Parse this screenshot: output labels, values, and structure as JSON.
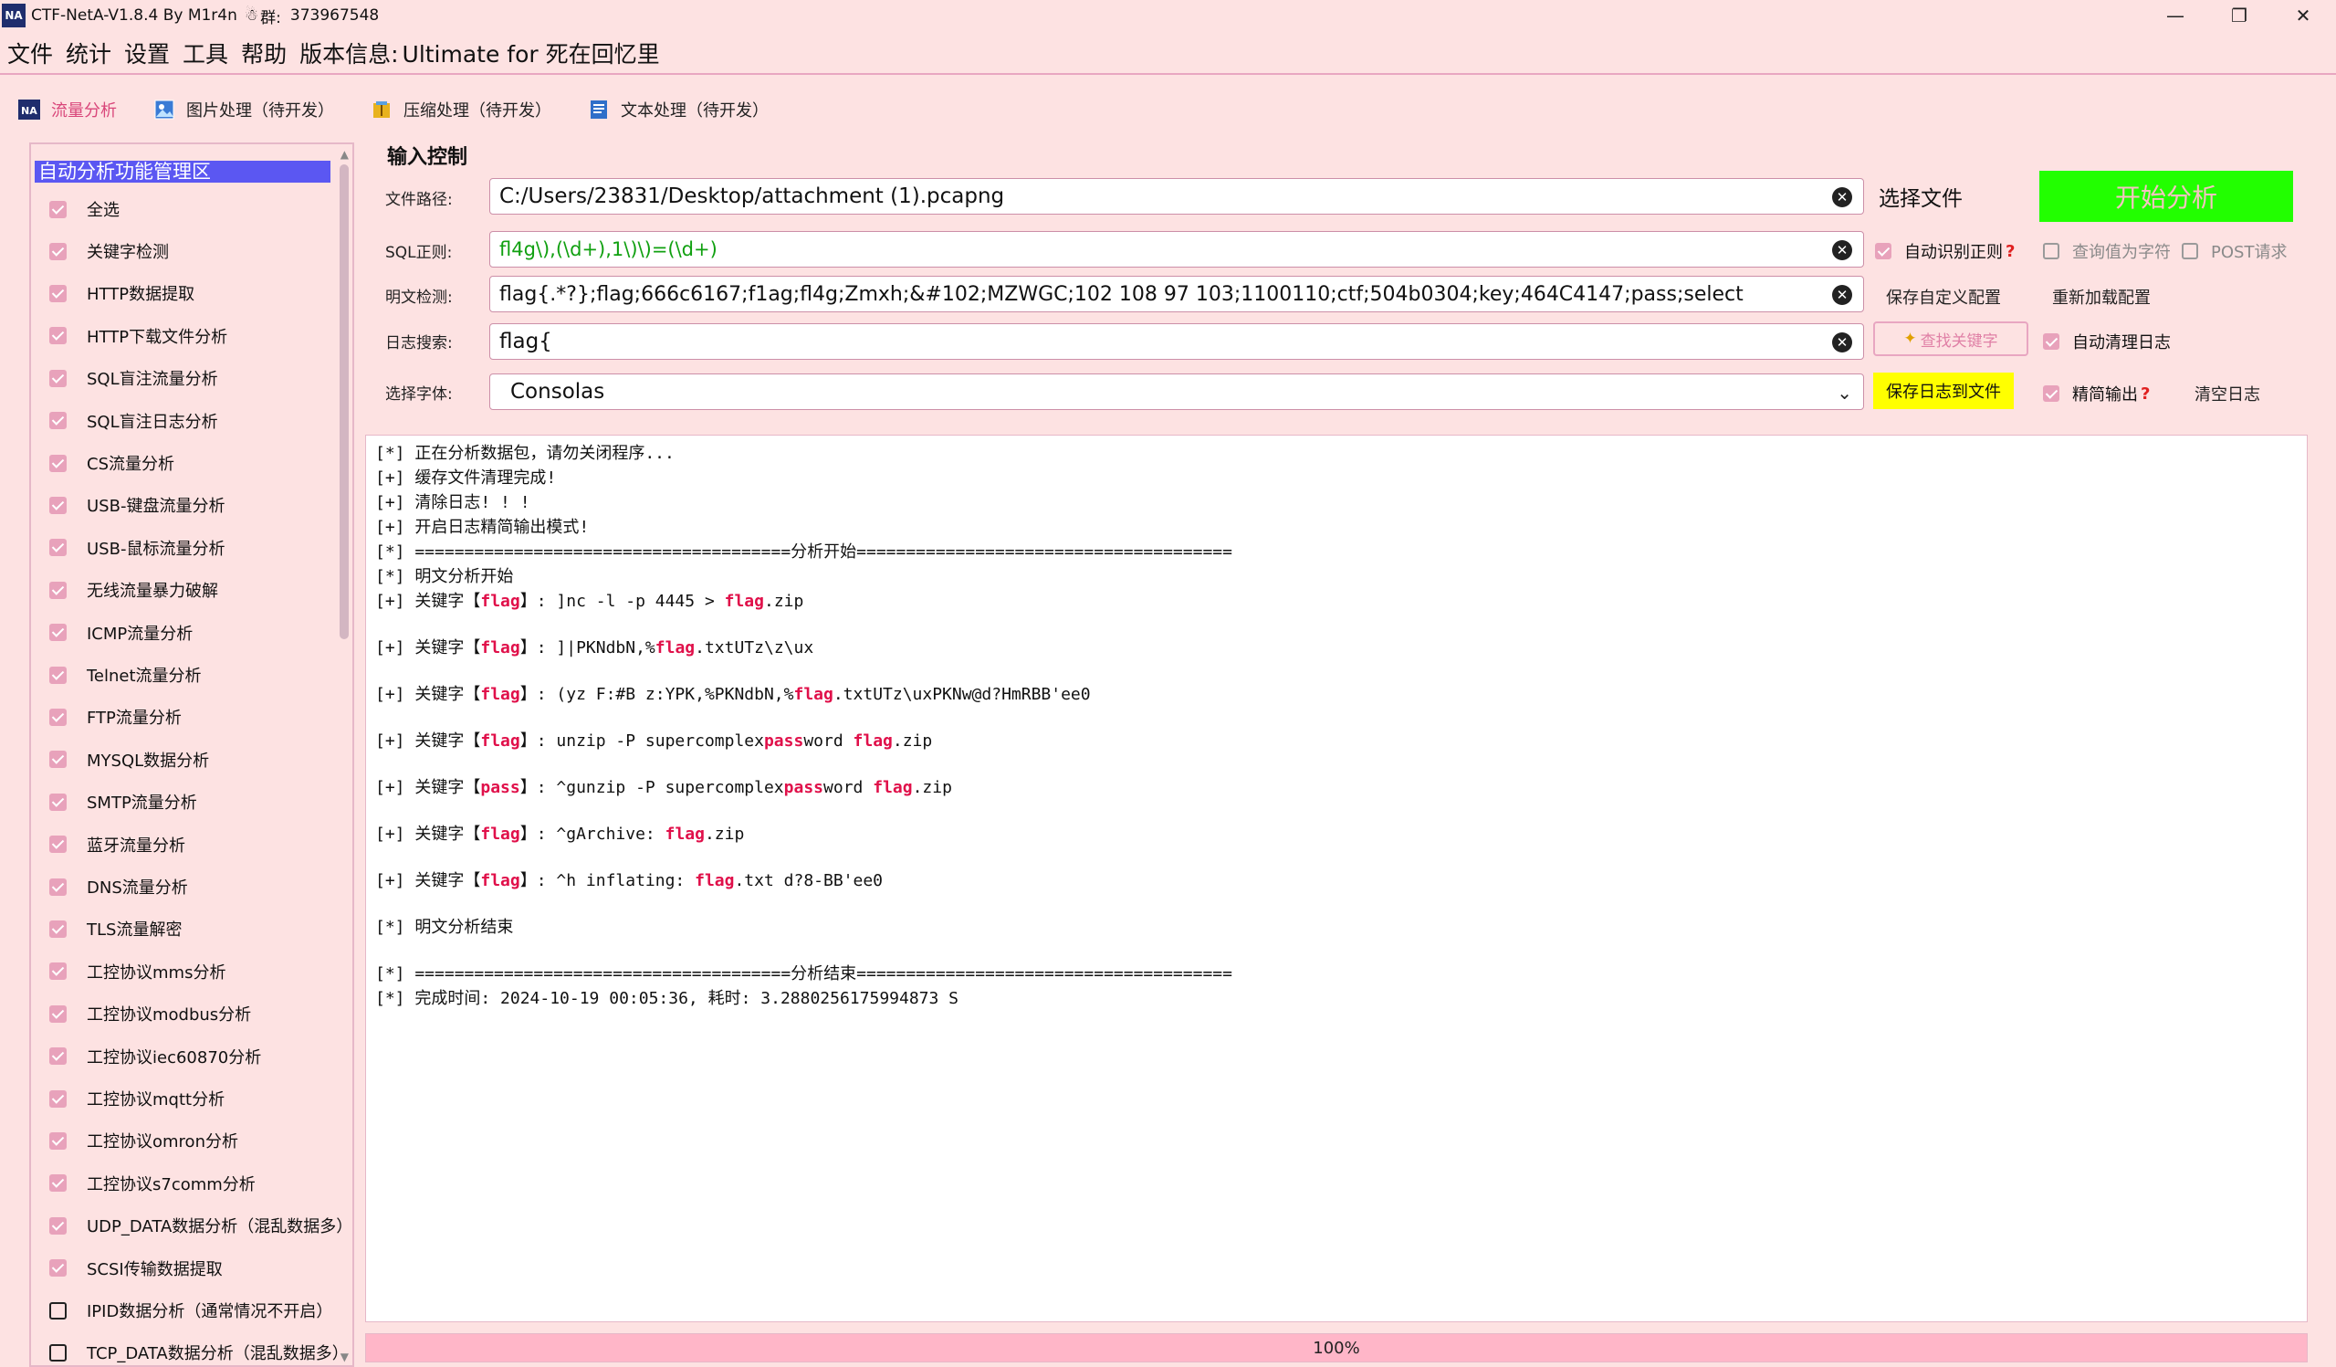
{
  "window": {
    "logo": "NA",
    "title": "CTF-NetA-V1.8.4 By M1r4n",
    "group_label": "群:",
    "group_number": "373967548",
    "minimize": "—",
    "maximize": "❐",
    "close": "✕"
  },
  "menu": {
    "items": [
      "文件",
      "统计",
      "设置",
      "工具",
      "帮助"
    ],
    "version_label": "版本信息:",
    "version_value": "Ultimate for 死在回忆里"
  },
  "tabs": [
    {
      "label": "流量分析",
      "active": true,
      "icon": "na-logo-icon"
    },
    {
      "label": "图片处理（待开发）",
      "active": false,
      "icon": "image-icon"
    },
    {
      "label": "压缩处理（待开发）",
      "active": false,
      "icon": "archive-icon"
    },
    {
      "label": "文本处理（待开发）",
      "active": false,
      "icon": "document-icon"
    }
  ],
  "sidebar": {
    "header": "自动分析功能管理区",
    "select_all": "全选",
    "items": [
      {
        "label": "关键字检测",
        "checked": true
      },
      {
        "label": "HTTP数据提取",
        "checked": true
      },
      {
        "label": "HTTP下载文件分析",
        "checked": true
      },
      {
        "label": "SQL盲注流量分析",
        "checked": true
      },
      {
        "label": "SQL盲注日志分析",
        "checked": true
      },
      {
        "label": "CS流量分析",
        "checked": true
      },
      {
        "label": "USB-键盘流量分析",
        "checked": true
      },
      {
        "label": "USB-鼠标流量分析",
        "checked": true
      },
      {
        "label": "无线流量暴力破解",
        "checked": true
      },
      {
        "label": "ICMP流量分析",
        "checked": true
      },
      {
        "label": "Telnet流量分析",
        "checked": true
      },
      {
        "label": "FTP流量分析",
        "checked": true
      },
      {
        "label": "MYSQL数据分析",
        "checked": true
      },
      {
        "label": "SMTP流量分析",
        "checked": true
      },
      {
        "label": "蓝牙流量分析",
        "checked": true
      },
      {
        "label": "DNS流量分析",
        "checked": true
      },
      {
        "label": "TLS流量解密",
        "checked": true
      },
      {
        "label": "工控协议mms分析",
        "checked": true
      },
      {
        "label": "工控协议modbus分析",
        "checked": true
      },
      {
        "label": "工控协议iec60870分析",
        "checked": true
      },
      {
        "label": "工控协议mqtt分析",
        "checked": true
      },
      {
        "label": "工控协议omron分析",
        "checked": true
      },
      {
        "label": "工控协议s7comm分析",
        "checked": true
      },
      {
        "label": "UDP_DATA数据分析（混乱数据多）",
        "checked": true
      },
      {
        "label": "SCSI传输数据提取",
        "checked": true
      },
      {
        "label": "IPID数据分析（通常情况不开启）",
        "checked": false
      },
      {
        "label": "TCP_DATA数据分析（混乱数据多）",
        "checked": false
      }
    ]
  },
  "input": {
    "section_title": "输入控制",
    "file_path_label": "文件路径:",
    "file_path_value": "C:/Users/23831/Desktop/attachment (1).pcapng",
    "sql_regex_label": "SQL正则:",
    "sql_regex_value": "fl4g\\),(\\d+),1\\)\\)=(\\d+)",
    "plaintext_label": "明文检测:",
    "plaintext_value": "flag{.*?};flag;666c6167;f1ag;fl4g;Zmxh;&#102;MZWGC;102 108 97 103;1100110;ctf;504b0304;key;464C4147;pass;select",
    "log_search_label": "日志搜索:",
    "log_search_value": "flag{",
    "font_label": "选择字体:",
    "font_value": "Consolas",
    "sql_color": "#10a010"
  },
  "actions": {
    "choose_file": "选择文件",
    "start_analysis": "开始分析",
    "auto_regex": "自动识别正则",
    "query_as_char": "查询值为字符",
    "post_request": "POST请求",
    "save_custom_config": "保存自定义配置",
    "reload_config": "重新加载配置",
    "find_keyword": "查找关键字",
    "auto_clear_log": "自动清理日志",
    "save_log_to_file": "保存日志到文件",
    "concise_output": "精简输出",
    "clear_log": "清空日志",
    "help_mark": "?"
  },
  "log": [
    {
      "parts": [
        {
          "t": "[*] 正在分析数据包，请勿关闭程序..."
        }
      ]
    },
    {
      "parts": [
        {
          "t": "[+] 缓存文件清理完成!"
        }
      ]
    },
    {
      "parts": [
        {
          "t": "[+] 清除日志! ! !"
        }
      ]
    },
    {
      "parts": [
        {
          "t": "[+] 开启日志精简输出模式!"
        }
      ]
    },
    {
      "parts": [
        {
          "t": "[*] ======================================分析开始======================================"
        }
      ]
    },
    {
      "parts": [
        {
          "t": "[*] 明文分析开始"
        }
      ]
    },
    {
      "parts": [
        {
          "t": "[+] 关键字【"
        },
        {
          "t": "flag",
          "kw": true
        },
        {
          "t": "】: ]nc -l -p 4445 > "
        },
        {
          "t": "flag",
          "kw": true
        },
        {
          "t": ".zip"
        }
      ]
    },
    {
      "gap": true
    },
    {
      "parts": [
        {
          "t": "[+] 关键字【"
        },
        {
          "t": "flag",
          "kw": true
        },
        {
          "t": "】: ]|PKNdbN,%"
        },
        {
          "t": "flag",
          "kw": true
        },
        {
          "t": ".txtUTz\\z\\ux"
        }
      ]
    },
    {
      "gap": true
    },
    {
      "parts": [
        {
          "t": "[+] 关键字【"
        },
        {
          "t": "flag",
          "kw": true
        },
        {
          "t": "】: (yz F:#B z:YPK,%PKNdbN,%"
        },
        {
          "t": "flag",
          "kw": true
        },
        {
          "t": ".txtUTz\\uxPKNw@d?HmRBB'ee0"
        }
      ]
    },
    {
      "gap": true
    },
    {
      "parts": [
        {
          "t": "[+] 关键字【"
        },
        {
          "t": "flag",
          "kw": true
        },
        {
          "t": "】: unzip -P supercomplex"
        },
        {
          "t": "pass",
          "kw": true
        },
        {
          "t": "word "
        },
        {
          "t": "flag",
          "kw": true
        },
        {
          "t": ".zip"
        }
      ]
    },
    {
      "gap": true
    },
    {
      "parts": [
        {
          "t": "[+] 关键字【"
        },
        {
          "t": "pass",
          "kw": true
        },
        {
          "t": "】: ^gunzip -P supercomplex"
        },
        {
          "t": "pass",
          "kw": true
        },
        {
          "t": "word "
        },
        {
          "t": "flag",
          "kw": true
        },
        {
          "t": ".zip"
        }
      ]
    },
    {
      "gap": true
    },
    {
      "parts": [
        {
          "t": "[+] 关键字【"
        },
        {
          "t": "flag",
          "kw": true
        },
        {
          "t": "】: ^gArchive: "
        },
        {
          "t": "flag",
          "kw": true
        },
        {
          "t": ".zip"
        }
      ]
    },
    {
      "gap": true
    },
    {
      "parts": [
        {
          "t": "[+] 关键字【"
        },
        {
          "t": "flag",
          "kw": true
        },
        {
          "t": "】: ^h inflating: "
        },
        {
          "t": "flag",
          "kw": true
        },
        {
          "t": ".txt d?8-BB'ee0"
        }
      ]
    },
    {
      "gap": true
    },
    {
      "parts": [
        {
          "t": "[*] 明文分析结束"
        }
      ]
    },
    {
      "gap": true
    },
    {
      "parts": [
        {
          "t": "[*] ======================================分析结束======================================"
        }
      ]
    },
    {
      "parts": [
        {
          "t": "[*] 完成时间: 2024-10-19 00:05:36, 耗时: 3.2880256175994873 S"
        }
      ]
    }
  ],
  "progress": {
    "label": "100%",
    "value": 1.0
  },
  "colors": {
    "background": "#fde2e2",
    "accent_pink": "#d9467a",
    "start_button": "#22ff00",
    "save_log_button": "#ffff00",
    "keyword": "#e0104a",
    "sidebar_header": "#5b57f2"
  }
}
